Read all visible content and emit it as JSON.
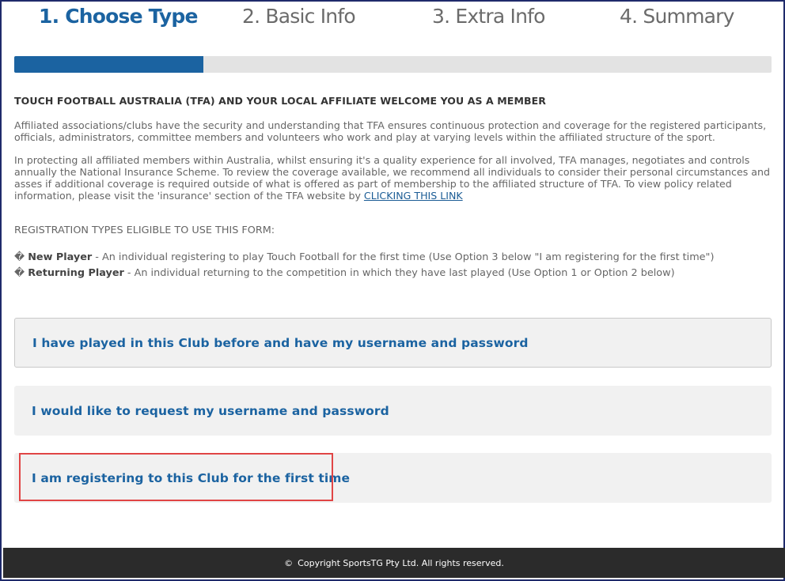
{
  "steps": [
    {
      "label": "1. Choose Type",
      "active": true
    },
    {
      "label": "2. Basic Info",
      "active": false
    },
    {
      "label": "3. Extra Info",
      "active": false
    },
    {
      "label": "4. Summary",
      "active": false
    }
  ],
  "progress": {
    "percent": 25
  },
  "intro": {
    "heading": "TOUCH FOOTBALL AUSTRALIA (TFA) AND YOUR LOCAL AFFILIATE WELCOME YOU AS A MEMBER",
    "para1": "Affiliated associations/clubs have the security and understanding that TFA ensures continuous protection and coverage for the registered participants, officials, administrators, committee members and volunteers who work and play at varying levels within the affiliated structure of the sport.",
    "para2": "In protecting all affiliated members within Australia, whilst ensuring it's a quality experience for all involved, TFA manages, negotiates and controls annually the National Insurance Scheme. To review the coverage available, we recommend all individuals to consider their personal circumstances and asses if additional coverage is required outside of what is offered as part of membership to the affiliated structure of TFA. To view policy related information, please visit the 'insurance' section of the TFA website by ",
    "link": "CLICKING THIS LINK"
  },
  "types": {
    "title": "REGISTRATION TYPES ELIGIBLE TO USE THIS FORM:",
    "bullet": "�",
    "new_player_label": "New Player",
    "new_player_desc": " - An individual registering to play Touch Football for the first time (Use Option 3 below \"I am registering for the first time\")",
    "returning_player_label": "Returning Player",
    "returning_player_desc": " - An individual returning to the competition in which they have last played (Use Option 1 or Option 2 below)"
  },
  "options": {
    "option1": "I have played in this Club before and have my username and password",
    "option2": "I would like to request my username and password",
    "option3": "I am registering to this Club for the first time"
  },
  "footer": {
    "copyright_symbol": "©",
    "text": "Copyright SportsTG Pty Ltd. All rights reserved."
  },
  "colors": {
    "accent": "#1b63a1",
    "highlight_border": "#e04545",
    "footer_bg": "#2b2b2b"
  }
}
